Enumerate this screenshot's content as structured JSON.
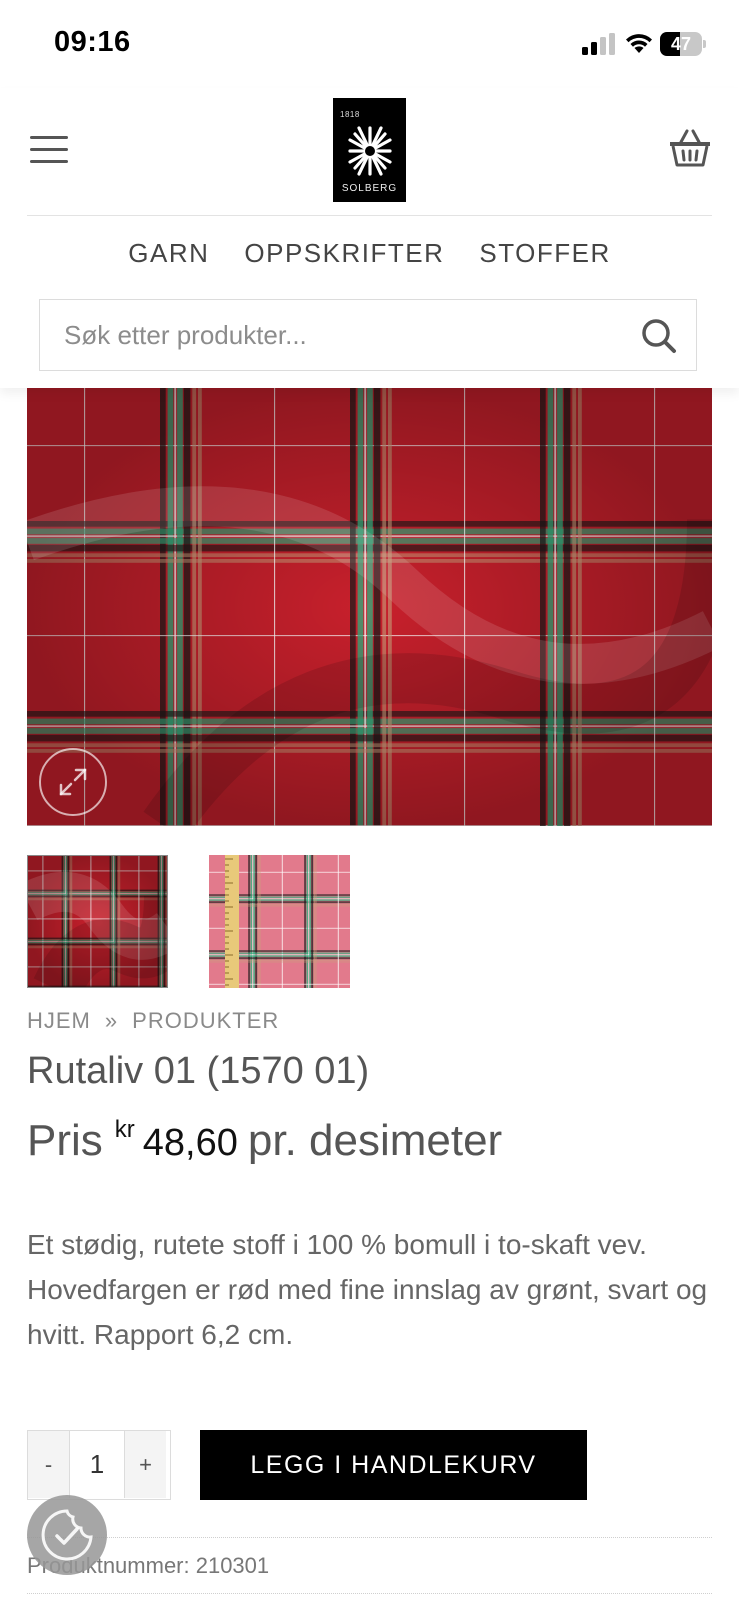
{
  "status_bar": {
    "time": "09:16",
    "battery_level": "47",
    "icons": [
      "signal-icon",
      "wifi-icon",
      "battery-icon"
    ]
  },
  "header": {
    "logo": {
      "year": "1818",
      "name": "SOLBERG"
    },
    "icons": [
      "menu-icon",
      "cart-icon"
    ],
    "nav": [
      "GARN",
      "OPPSKRIFTER",
      "STOFFER"
    ],
    "search": {
      "placeholder": "Søk etter produkter...",
      "value": ""
    }
  },
  "gallery": {
    "thumbnail_count": 2,
    "colors": {
      "base": "#c8202c",
      "green": "#2fb07f",
      "black": "#1a1a1a",
      "white": "#ffffff",
      "thumb2_base": "#e27a8c"
    }
  },
  "product": {
    "breadcrumb": [
      "HJEM",
      "»",
      "PRODUKTER"
    ],
    "title": "Rutaliv 01 (1570 01)",
    "price": {
      "label": "Pris",
      "currency": "kr",
      "amount": "48,60",
      "unit": "pr. desimeter"
    },
    "description": "Et stødig, rutete stoff i 100 % bomull i to-skaft vev. Hovedfargen er rød med fine innslag av grønt, svart og hvitt. Rapport 6,2 cm.",
    "quantity": {
      "minus": "-",
      "value": "1",
      "plus": "+"
    },
    "add_to_cart": "LEGG I HANDLEKURV",
    "sku": "Produktnummer: 210301"
  }
}
